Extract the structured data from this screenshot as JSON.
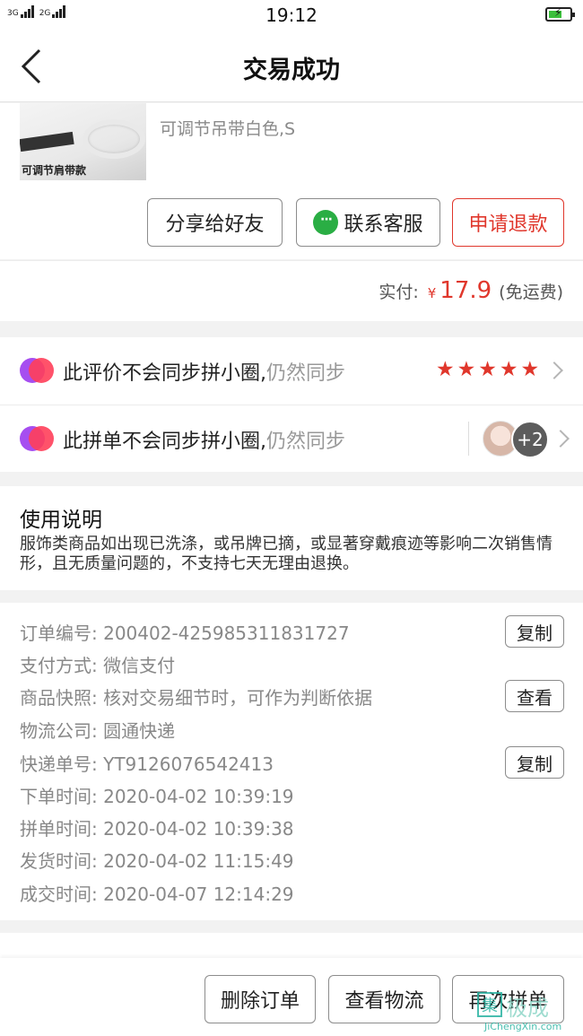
{
  "status_bar": {
    "time": "19:12",
    "signal_1": "3G",
    "signal_2": "3G",
    "signal_3": "2G"
  },
  "nav": {
    "title": "交易成功"
  },
  "product": {
    "thumb_label": "可调节肩带款",
    "variant": "可调节吊带白色,S",
    "share_label": "分享给好友",
    "contact_label": "联系客服",
    "refund_label": "申请退款"
  },
  "payment": {
    "label": "实付:",
    "currency": "¥",
    "amount": "17.9",
    "note": "(免运费)"
  },
  "sync": {
    "review_text": "此评价不会同步拼小圈,",
    "review_action": "仍然同步",
    "review_rating": 5,
    "order_text": "此拼单不会同步拼小圈,",
    "order_action": "仍然同步",
    "more_count": "+2"
  },
  "usage": {
    "title": "使用说明",
    "body": "服饰类商品如出现已洗涤，或吊牌已摘，或显著穿戴痕迹等影响二次销售情形，且无质量问题的，不支持七天无理由退换。"
  },
  "details": {
    "rows": [
      {
        "label": "订单编号:",
        "value": "200402-425985311831727",
        "button": "复制"
      },
      {
        "label": "支付方式:",
        "value": "微信支付"
      },
      {
        "label": "商品快照:",
        "value": "核对交易细节时，可作为判断依据",
        "button": "查看"
      },
      {
        "label": "物流公司:",
        "value": "圆通快递"
      },
      {
        "label": "快递单号:",
        "value": "YT9126076542413",
        "button": "复制"
      },
      {
        "label": "下单时间:",
        "value": "2020-04-02 10:39:19"
      },
      {
        "label": "拼单时间:",
        "value": "2020-04-02 10:39:38"
      },
      {
        "label": "发货时间:",
        "value": "2020-04-02 11:15:49"
      },
      {
        "label": "成交时间:",
        "value": "2020-04-07 12:14:29"
      }
    ]
  },
  "bottom": {
    "delete_label": "删除订单",
    "logistics_label": "查看物流",
    "again_label": "再次拼单"
  },
  "watermark": {
    "text": "极成",
    "url": "JiChengXin.com"
  },
  "colors": {
    "accent_red": "#e0372c",
    "wechat_green": "#2aae44"
  }
}
